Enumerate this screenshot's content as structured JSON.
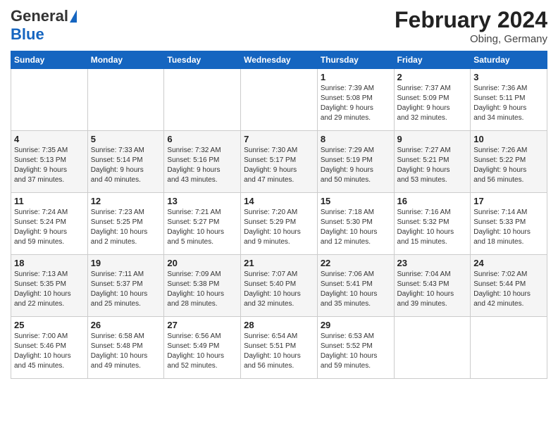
{
  "header": {
    "logo_line1": "General",
    "logo_line2": "Blue",
    "month_year": "February 2024",
    "location": "Obing, Germany"
  },
  "days_of_week": [
    "Sunday",
    "Monday",
    "Tuesday",
    "Wednesday",
    "Thursday",
    "Friday",
    "Saturday"
  ],
  "weeks": [
    [
      {
        "day": "",
        "info": ""
      },
      {
        "day": "",
        "info": ""
      },
      {
        "day": "",
        "info": ""
      },
      {
        "day": "",
        "info": ""
      },
      {
        "day": "1",
        "info": "Sunrise: 7:39 AM\nSunset: 5:08 PM\nDaylight: 9 hours\nand 29 minutes."
      },
      {
        "day": "2",
        "info": "Sunrise: 7:37 AM\nSunset: 5:09 PM\nDaylight: 9 hours\nand 32 minutes."
      },
      {
        "day": "3",
        "info": "Sunrise: 7:36 AM\nSunset: 5:11 PM\nDaylight: 9 hours\nand 34 minutes."
      }
    ],
    [
      {
        "day": "4",
        "info": "Sunrise: 7:35 AM\nSunset: 5:13 PM\nDaylight: 9 hours\nand 37 minutes."
      },
      {
        "day": "5",
        "info": "Sunrise: 7:33 AM\nSunset: 5:14 PM\nDaylight: 9 hours\nand 40 minutes."
      },
      {
        "day": "6",
        "info": "Sunrise: 7:32 AM\nSunset: 5:16 PM\nDaylight: 9 hours\nand 43 minutes."
      },
      {
        "day": "7",
        "info": "Sunrise: 7:30 AM\nSunset: 5:17 PM\nDaylight: 9 hours\nand 47 minutes."
      },
      {
        "day": "8",
        "info": "Sunrise: 7:29 AM\nSunset: 5:19 PM\nDaylight: 9 hours\nand 50 minutes."
      },
      {
        "day": "9",
        "info": "Sunrise: 7:27 AM\nSunset: 5:21 PM\nDaylight: 9 hours\nand 53 minutes."
      },
      {
        "day": "10",
        "info": "Sunrise: 7:26 AM\nSunset: 5:22 PM\nDaylight: 9 hours\nand 56 minutes."
      }
    ],
    [
      {
        "day": "11",
        "info": "Sunrise: 7:24 AM\nSunset: 5:24 PM\nDaylight: 9 hours\nand 59 minutes."
      },
      {
        "day": "12",
        "info": "Sunrise: 7:23 AM\nSunset: 5:25 PM\nDaylight: 10 hours\nand 2 minutes."
      },
      {
        "day": "13",
        "info": "Sunrise: 7:21 AM\nSunset: 5:27 PM\nDaylight: 10 hours\nand 5 minutes."
      },
      {
        "day": "14",
        "info": "Sunrise: 7:20 AM\nSunset: 5:29 PM\nDaylight: 10 hours\nand 9 minutes."
      },
      {
        "day": "15",
        "info": "Sunrise: 7:18 AM\nSunset: 5:30 PM\nDaylight: 10 hours\nand 12 minutes."
      },
      {
        "day": "16",
        "info": "Sunrise: 7:16 AM\nSunset: 5:32 PM\nDaylight: 10 hours\nand 15 minutes."
      },
      {
        "day": "17",
        "info": "Sunrise: 7:14 AM\nSunset: 5:33 PM\nDaylight: 10 hours\nand 18 minutes."
      }
    ],
    [
      {
        "day": "18",
        "info": "Sunrise: 7:13 AM\nSunset: 5:35 PM\nDaylight: 10 hours\nand 22 minutes."
      },
      {
        "day": "19",
        "info": "Sunrise: 7:11 AM\nSunset: 5:37 PM\nDaylight: 10 hours\nand 25 minutes."
      },
      {
        "day": "20",
        "info": "Sunrise: 7:09 AM\nSunset: 5:38 PM\nDaylight: 10 hours\nand 28 minutes."
      },
      {
        "day": "21",
        "info": "Sunrise: 7:07 AM\nSunset: 5:40 PM\nDaylight: 10 hours\nand 32 minutes."
      },
      {
        "day": "22",
        "info": "Sunrise: 7:06 AM\nSunset: 5:41 PM\nDaylight: 10 hours\nand 35 minutes."
      },
      {
        "day": "23",
        "info": "Sunrise: 7:04 AM\nSunset: 5:43 PM\nDaylight: 10 hours\nand 39 minutes."
      },
      {
        "day": "24",
        "info": "Sunrise: 7:02 AM\nSunset: 5:44 PM\nDaylight: 10 hours\nand 42 minutes."
      }
    ],
    [
      {
        "day": "25",
        "info": "Sunrise: 7:00 AM\nSunset: 5:46 PM\nDaylight: 10 hours\nand 45 minutes."
      },
      {
        "day": "26",
        "info": "Sunrise: 6:58 AM\nSunset: 5:48 PM\nDaylight: 10 hours\nand 49 minutes."
      },
      {
        "day": "27",
        "info": "Sunrise: 6:56 AM\nSunset: 5:49 PM\nDaylight: 10 hours\nand 52 minutes."
      },
      {
        "day": "28",
        "info": "Sunrise: 6:54 AM\nSunset: 5:51 PM\nDaylight: 10 hours\nand 56 minutes."
      },
      {
        "day": "29",
        "info": "Sunrise: 6:53 AM\nSunset: 5:52 PM\nDaylight: 10 hours\nand 59 minutes."
      },
      {
        "day": "",
        "info": ""
      },
      {
        "day": "",
        "info": ""
      }
    ]
  ]
}
